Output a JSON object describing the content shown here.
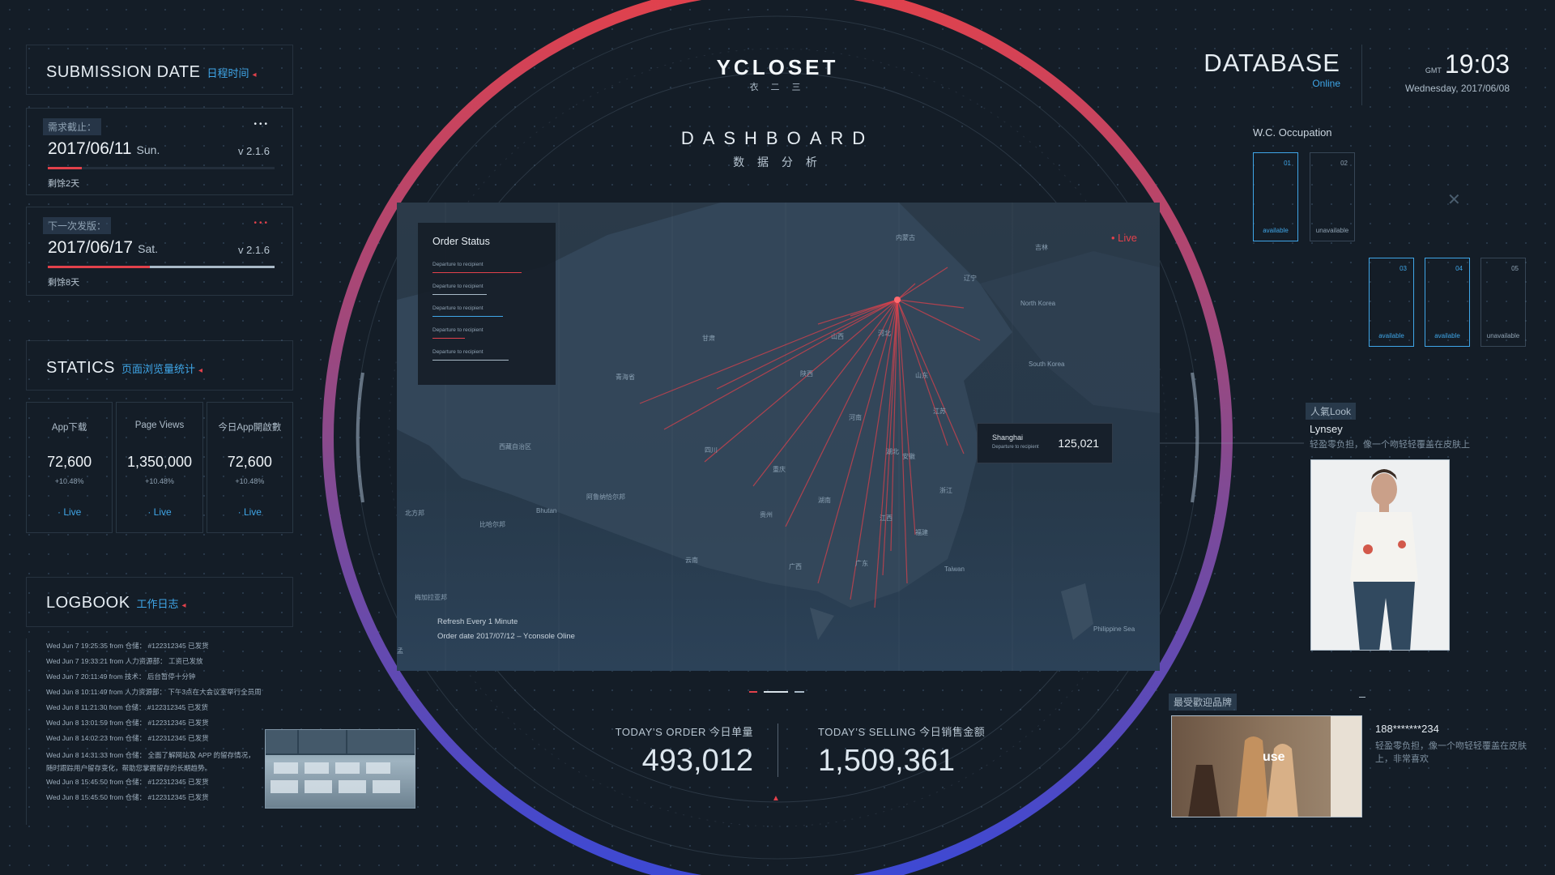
{
  "submission": {
    "title": "SUBMISSION DATE",
    "subtitle": "日程时间",
    "cards": [
      {
        "tag": "需求截止：",
        "date": "2017/06/11",
        "day": "Sun.",
        "version": "v 2.1.6",
        "remain": "剩馀2天",
        "progress": 0.15
      },
      {
        "tag": "下一次发版：",
        "date": "2017/06/17",
        "day": "Sat.",
        "version": "v 2.1.6",
        "remain": "剩馀8天",
        "progress": 0.45
      }
    ]
  },
  "statics": {
    "title": "STATICS",
    "subtitle": "页面浏览量统计",
    "items": [
      {
        "label": "App下载",
        "value": "72,600",
        "change": "+10.48%",
        "live": "· Live"
      },
      {
        "label": "Page Views",
        "value": "1,350,000",
        "change": "+10.48%",
        "live": "· Live"
      },
      {
        "label": "今日App開啟數",
        "value": "72,600",
        "change": "+10.48%",
        "live": "· Live"
      }
    ]
  },
  "logbook": {
    "title": "LOGBOOK",
    "subtitle": "工作日志",
    "lines": [
      "Wed Jun 7 19:25:35 from 仓储：  #122312345  已发货",
      "Wed Jun 7 19:33:21 from 人力资源部：  工资已发放",
      "Wed Jun 7 20:11:49 from 技术：  后台暂停十分钟",
      "Wed Jun 8 10:11:49 from 人力资源部：  下午3点在大会议室举行全员周",
      "Wed Jun 8 11:21:30 from 仓储：  #122312345  已发货",
      "Wed Jun 8 13:01:59 from 仓储：  #122312345  已发货",
      "Wed Jun 8 14:02:23 from 仓储：  #122312345  已发货",
      "Wed Jun 8 14:31:33 from 仓储：  全面了解网站及 APP 的留存情况，",
      "随时跟踪用户留存变化，帮助您掌握留存的长期趋势。",
      "Wed Jun 8 15:45:50 from 仓储：  #122312345  已发货",
      "Wed Jun 8 15:45:50 from 仓储：  #122312345  已发货"
    ]
  },
  "header": {
    "brand": "YCLOSET",
    "brand_sub": "衣 二 三",
    "dashboard": "DASHBOARD",
    "dashboard_sub": "数 据 分 析"
  },
  "map": {
    "order_status_title": "Order Status",
    "order_items": [
      {
        "label": "Departure to recipient",
        "progress": 0.82,
        "color": "#e2414b"
      },
      {
        "label": "Departure to recipient",
        "progress": 0.5,
        "color": "#a9bac8"
      },
      {
        "label": "Departure to recipient",
        "progress": 0.65,
        "color": "#3fa6e8"
      },
      {
        "label": "Departure to recipient",
        "progress": 0.3,
        "color": "#e2414b"
      },
      {
        "label": "Departure to recipient",
        "progress": 0.7,
        "color": "#a9bac8"
      }
    ],
    "live": "• Live",
    "shanghai_city": "Shanghai",
    "shanghai_sub": "Departure to recipient",
    "shanghai_value": "125,021",
    "refresh": "Refresh Every 1 Minute",
    "order_date": "Order date 2017/07/12 – Yconsole Oline",
    "places": [
      "内蒙古",
      "吉林",
      "辽宁",
      "North Korea",
      "South Korea",
      "甘肃",
      "山西",
      "河北",
      "山东",
      "陕西",
      "青海省",
      "江苏",
      "河南",
      "西藏自治区",
      "四川",
      "湖北",
      "安徽",
      "重庆",
      "浙江",
      "阿鲁纳恰尔邦",
      "Bhutan",
      "贵州",
      "湖南",
      "江西",
      "北方邦",
      "比哈尔邦",
      "福建",
      "云南",
      "广西",
      "广东",
      "Taiwan",
      "梅加拉亚邦",
      "Philippine Sea",
      "孟"
    ]
  },
  "kpis": [
    {
      "label": "TODAY’S ORDER  今日单量",
      "value": "493,012"
    },
    {
      "label": "TODAY’S SELLING  今日销售金额",
      "value": "1,509,361"
    }
  ],
  "database": {
    "title": "DATABASE",
    "status": "Online",
    "gmt": "GMT",
    "time": "19:03",
    "date": "Wednesday, 2017/06/08"
  },
  "wc": {
    "title": "W.C. Occupation",
    "rooms": [
      {
        "num": "01",
        "status": "available"
      },
      {
        "num": "02",
        "status": "unavailable"
      },
      {
        "num": "03",
        "status": "available"
      },
      {
        "num": "04",
        "status": "available"
      },
      {
        "num": "05",
        "status": "unavailable"
      }
    ]
  },
  "popular": {
    "tag": "人氣Look",
    "name": "Lynsey",
    "desc": "轻盈零负担，像一个吻轻轻覆盖在皮肤上"
  },
  "favorite": {
    "tag": "最受歡迎品牌",
    "logo_text": "use",
    "user": "188*******234",
    "desc": "轻盈零负担，像一个吻轻轻覆盖在皮肤上，非常喜欢"
  },
  "colors": {
    "accent_blue": "#3fa6e8",
    "accent_red": "#e2414b",
    "bg": "#141d27"
  }
}
